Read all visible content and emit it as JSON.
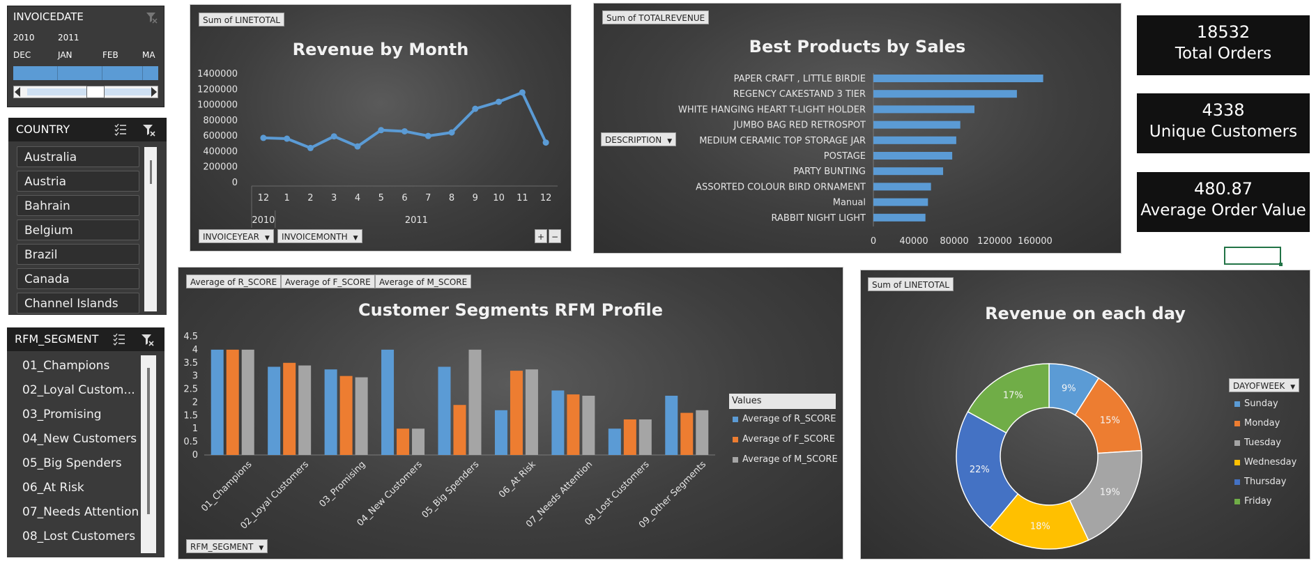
{
  "slicers": {
    "invoicedate": {
      "title": "INVOICEDATE",
      "years": [
        "2010",
        "2011"
      ],
      "months": [
        "DEC",
        "JAN",
        "FEB",
        "MA"
      ]
    },
    "country": {
      "title": "COUNTRY",
      "items": [
        "Australia",
        "Austria",
        "Bahrain",
        "Belgium",
        "Brazil",
        "Canada",
        "Channel Islands"
      ]
    },
    "rfm_segment": {
      "title": "RFM_SEGMENT",
      "items": [
        "01_Champions",
        "02_Loyal Custom...",
        "03_Promising",
        "04_New Customers",
        "05_Big Spenders",
        "06_At Risk",
        "07_Needs Attention",
        "08_Lost Customers"
      ]
    }
  },
  "revenue_chart": {
    "field_button": "Sum of LINETOTAL",
    "row_buttons": [
      "INVOICEYEAR",
      "INVOICEMONTH"
    ],
    "zoom_in": "+",
    "zoom_out": "−"
  },
  "products_chart": {
    "field_button": "Sum of TOTALREVENUE",
    "row_button": "DESCRIPTION"
  },
  "rfm_chart": {
    "field_buttons": [
      "Average of R_SCORE",
      "Average of F_SCORE",
      "Average of M_SCORE"
    ],
    "row_button": "RFM_SEGMENT",
    "legend_title": "Values"
  },
  "day_chart": {
    "field_button": "Sum of LINETOTAL",
    "legend_button": "DAYOFWEEK"
  },
  "kpis": [
    {
      "value": "18532",
      "label": "Total Orders"
    },
    {
      "value": "4338",
      "label": "Unique Customers"
    },
    {
      "value": "480.87",
      "label": "Average Order Value"
    }
  ],
  "colors": {
    "blue": "#5b9bd5",
    "orange": "#ed7d31",
    "gray": "#a5a5a5",
    "gold": "#ffc000",
    "dark_blue": "#4472c4",
    "green": "#70ad47",
    "selection_green": "#217346"
  },
  "chart_data": [
    {
      "type": "line",
      "title": "Revenue by Month",
      "x": [
        "12",
        "1",
        "2",
        "3",
        "4",
        "5",
        "6",
        "7",
        "8",
        "9",
        "10",
        "11",
        "12"
      ],
      "x_groups": [
        {
          "label": "2010",
          "count": 1
        },
        {
          "label": "2011",
          "count": 12
        }
      ],
      "series": [
        {
          "values": [
            575000,
            565000,
            445000,
            595000,
            465000,
            675000,
            660000,
            600000,
            645000,
            950000,
            1040000,
            1160000,
            515000
          ]
        }
      ],
      "yticks": [
        "0",
        "200000",
        "400000",
        "600000",
        "800000",
        "1000000",
        "1200000",
        "1400000"
      ],
      "ylim": [
        0,
        1400000
      ]
    },
    {
      "type": "bar",
      "orientation": "horizontal",
      "title": "Best Products by Sales",
      "categories": [
        "PAPER CRAFT , LITTLE BIRDIE",
        "REGENCY CAKESTAND 3 TIER",
        "WHITE HANGING HEART T-LIGHT HOLDER",
        "JUMBO BAG RED RETROSPOT",
        "MEDIUM CERAMIC TOP STORAGE JAR",
        "POSTAGE",
        "PARTY BUNTING",
        "ASSORTED COLOUR BIRD ORNAMENT",
        "Manual",
        "RABBIT NIGHT LIGHT"
      ],
      "values": [
        168000,
        142000,
        100000,
        86000,
        82000,
        78000,
        69000,
        57000,
        54000,
        51500
      ],
      "xticks": [
        "0",
        "40000",
        "80000",
        "120000",
        "160000"
      ],
      "xlim": [
        0,
        180000
      ]
    },
    {
      "type": "bar",
      "title": "Customer Segments RFM Profile",
      "categories": [
        "01_Champions",
        "02_Loyal Customers",
        "03_Promising",
        "04_New Customers",
        "05_Big Spenders",
        "06_At Risk",
        "07_Needs Attention",
        "08_Lost Customers",
        "09_Other Segments"
      ],
      "series": [
        {
          "name": "Average of R_SCORE",
          "values": [
            4.0,
            3.35,
            3.25,
            4.0,
            3.35,
            1.7,
            2.45,
            1.0,
            2.25
          ]
        },
        {
          "name": "Average of F_SCORE",
          "values": [
            4.0,
            3.5,
            3.0,
            1.0,
            1.9,
            3.2,
            2.3,
            1.35,
            1.6
          ]
        },
        {
          "name": "Average of M_SCORE",
          "values": [
            4.0,
            3.4,
            2.95,
            1.0,
            4.0,
            3.25,
            2.25,
            1.35,
            1.7
          ]
        }
      ],
      "yticks": [
        "0",
        "0.5",
        "1",
        "1.5",
        "2",
        "2.5",
        "3",
        "3.5",
        "4",
        "4.5"
      ],
      "ylim": [
        0,
        4.5
      ]
    },
    {
      "type": "pie",
      "variant": "doughnut",
      "title": "Revenue on each day",
      "categories": [
        "Sunday",
        "Monday",
        "Tuesday",
        "Wednesday",
        "Thursday",
        "Friday"
      ],
      "values": [
        9,
        15,
        19,
        18,
        22,
        17
      ],
      "labels": [
        "9%",
        "15%",
        "19%",
        "18%",
        "22%",
        "17%"
      ]
    }
  ]
}
